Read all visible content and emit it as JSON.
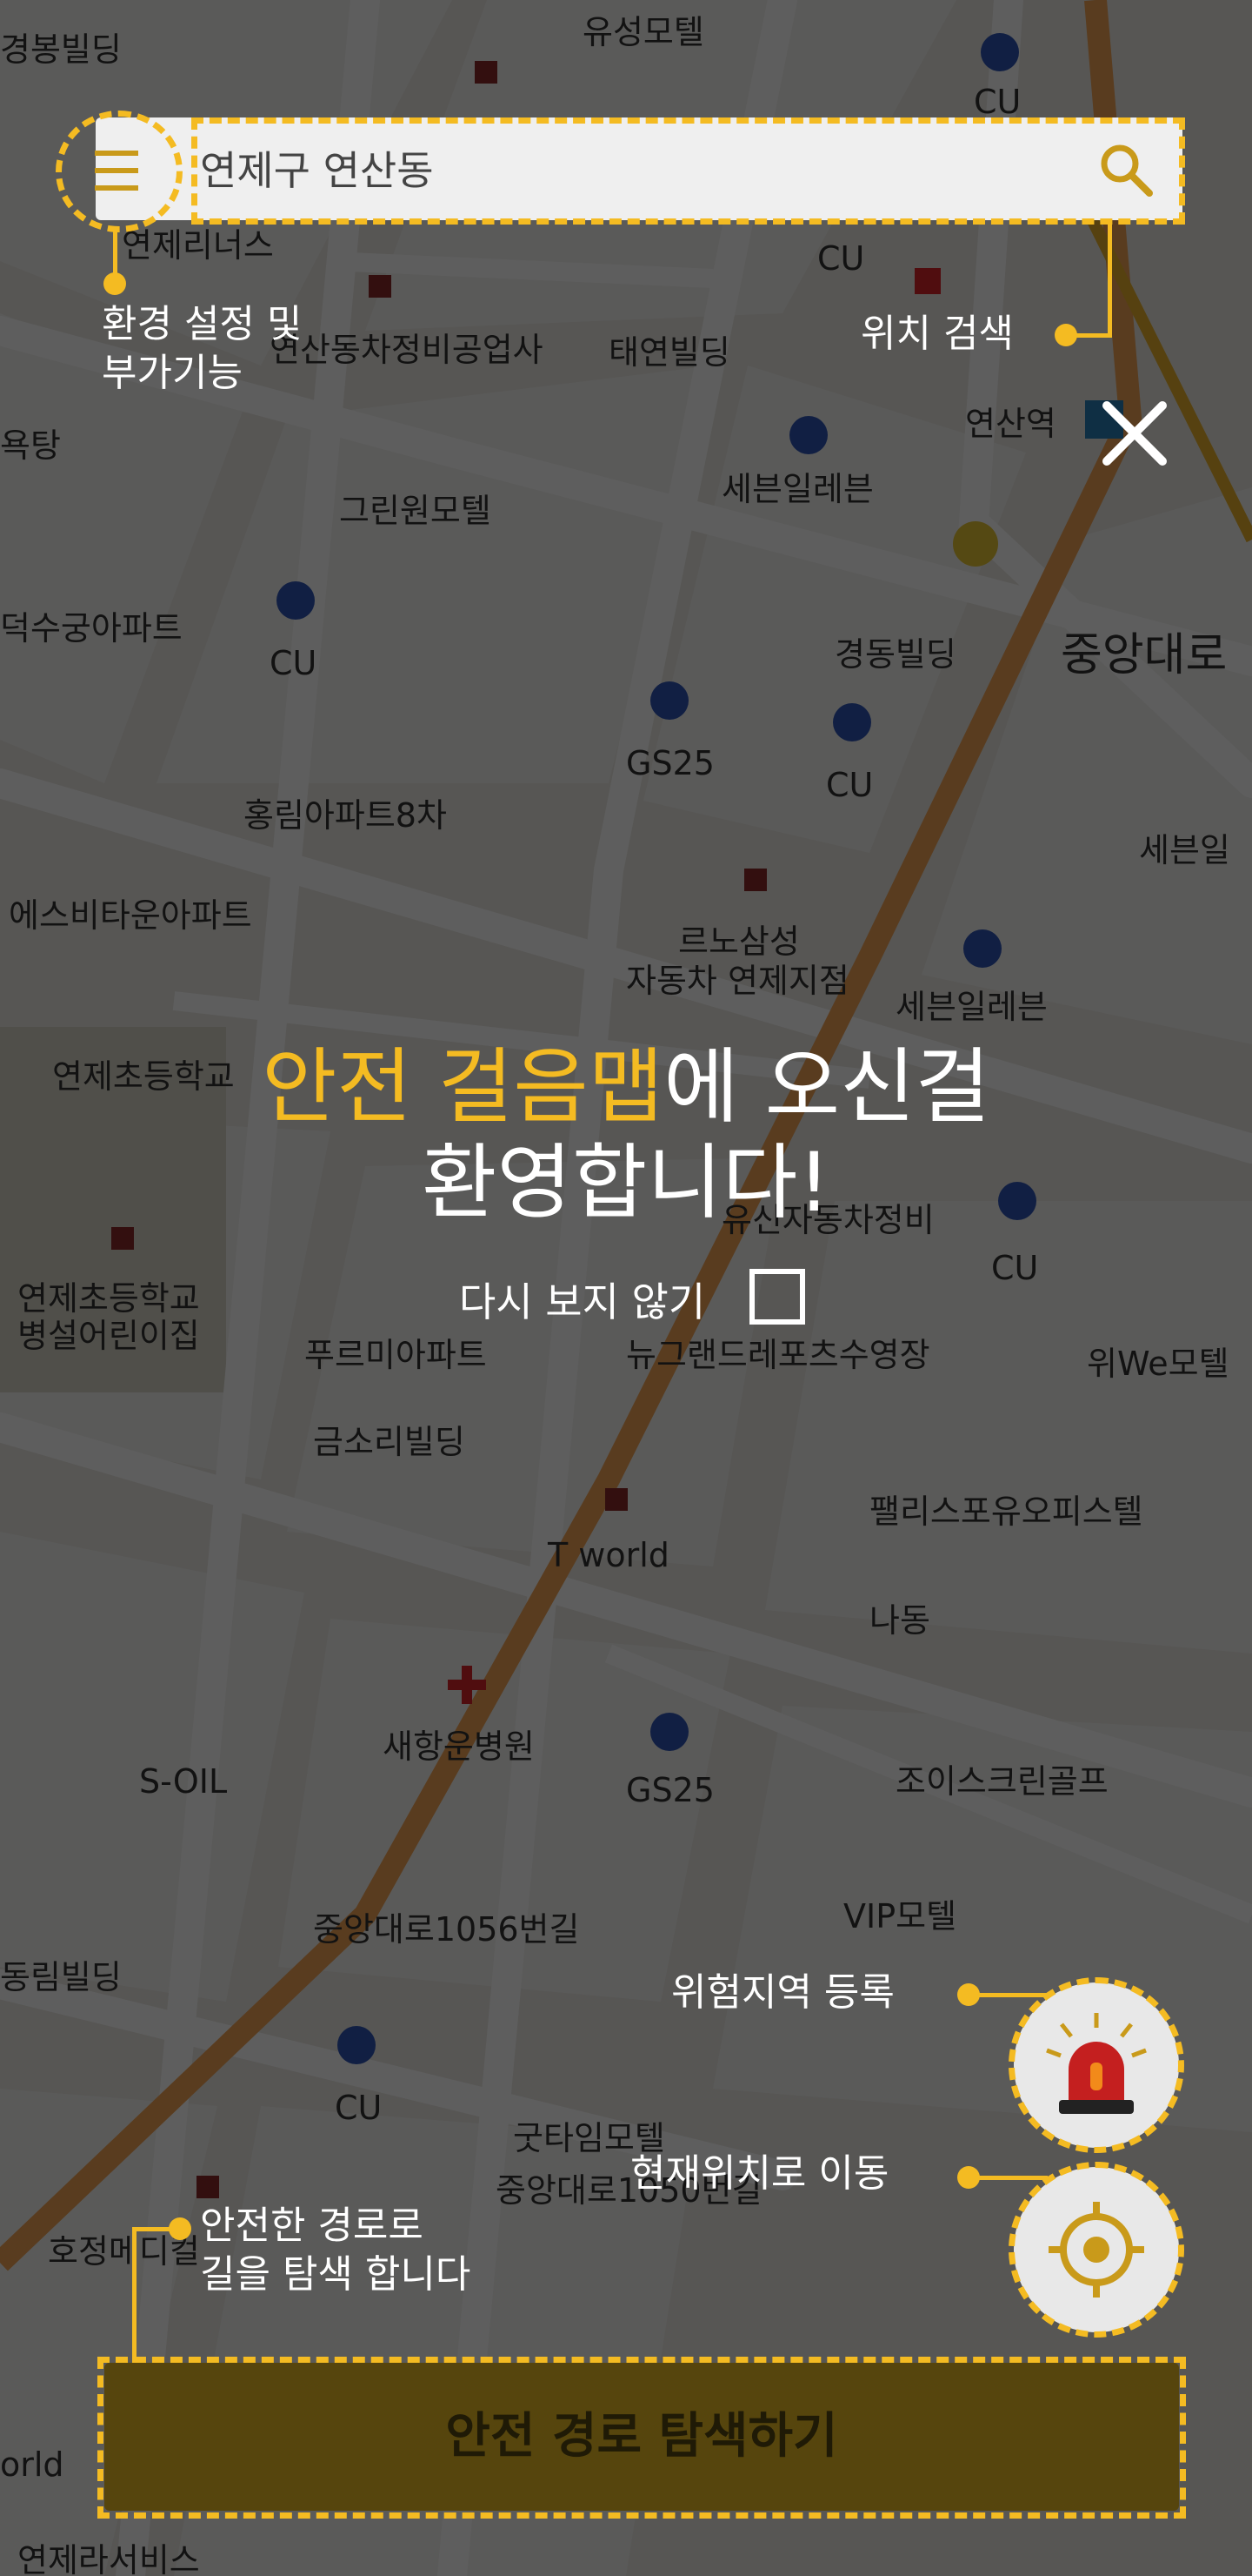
{
  "search": {
    "value": "연제구 연산동"
  },
  "map": {
    "labels": [
      "경봉빌딩",
      "유성모텔",
      "연제리너스",
      "CU",
      "CU",
      "연산동차정비공업사",
      "태연빌딩",
      "연산역",
      "세븐일레븐",
      "욕탕",
      "그린원모텔",
      "덕수궁아파트",
      "CU",
      "경동빌딩",
      "중앙대로",
      "GS25",
      "CU",
      "홍림아파트8차",
      "세븐일",
      "에스비타운아파트",
      "르노삼성 자동차 연제지점",
      "세븐일레븐",
      "연제초등학교",
      "유신자동차정비",
      "연제초등학교 병설어린이집",
      "푸르미아파트",
      "뉴그랜드레포츠수영장",
      "위We모텔",
      "CU",
      "금소리빌딩",
      "T world",
      "팰리스포유오피스텔",
      "나동",
      "새항운병원",
      "S-OIL",
      "GS25",
      "조이스크린골프",
      "VIP모텔",
      "중앙대로1056번길",
      "동림빌딩",
      "CU",
      "굿타임모텔",
      "중앙대로1050번길",
      "호정메디컬",
      "연제라서비스",
      "orld"
    ]
  },
  "menu": {
    "hint_line1": "환경 설정 및",
    "hint_line2": "부가기능"
  },
  "search_hint": {
    "label": "위치 검색"
  },
  "welcome": {
    "highlight": "안전 걸음맵",
    "rest_line1": "에 오신걸",
    "line2": "환영합니다!"
  },
  "dont_show": {
    "label": "다시 보지 않기",
    "checked": false
  },
  "danger_hint": {
    "label": "위험지역 등록"
  },
  "location_hint": {
    "label": "현재위치로 이동"
  },
  "route_hint": {
    "line1": "안전한 경로로",
    "line2": "길을 탐색 합니다"
  },
  "route_button": {
    "label": "안전 경로 탐색하기"
  },
  "colors": {
    "accent": "#f4bb22",
    "overlay": "rgba(0,0,0,0.63)",
    "button_dark": "#56450d"
  }
}
